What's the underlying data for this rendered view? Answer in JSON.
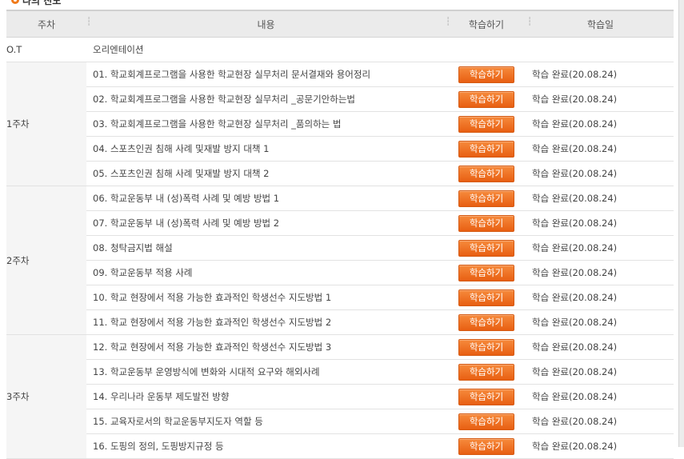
{
  "section_title": "나의 진도",
  "headers": {
    "week": "주차",
    "content": "내용",
    "study": "학습하기",
    "date": "학습일"
  },
  "separator_glyph": "┆",
  "ot": {
    "week": "O.T",
    "content": "오리엔테이션"
  },
  "weeks": [
    {
      "label": "1주차",
      "lessons": [
        {
          "title": "01. 학교회계프로그램을 사용한 학교현장 실무처리 문서결재와 용어정리",
          "button": "학습하기",
          "date": "학습 완료(20.08.24)"
        },
        {
          "title": "02. 학교회계프로그램을 사용한 학교현장 실무처리 _공문기안하는법",
          "button": "학습하기",
          "date": "학습 완료(20.08.24)"
        },
        {
          "title": "03. 학교회계프로그램을 사용한 학교현장 실무처리 _품의하는 법",
          "button": "학습하기",
          "date": "학습 완료(20.08.24)"
        },
        {
          "title": "04. 스포츠인권 침해 사례 및재발 방지 대책 1",
          "button": "학습하기",
          "date": "학습 완료(20.08.24)"
        },
        {
          "title": "05. 스포츠인권 침해 사례 및재발 방지 대책 2",
          "button": "학습하기",
          "date": "학습 완료(20.08.24)"
        }
      ]
    },
    {
      "label": "2주차",
      "lessons": [
        {
          "title": "06. 학교운동부 내 (성)폭력 사례 및 예방 방법 1",
          "button": "학습하기",
          "date": "학습 완료(20.08.24)"
        },
        {
          "title": "07. 학교운동부 내 (성)폭력 사례 및 예방 방법 2",
          "button": "학습하기",
          "date": "학습 완료(20.08.24)"
        },
        {
          "title": "08. 청탁금지법 해설",
          "button": "학습하기",
          "date": "학습 완료(20.08.24)"
        },
        {
          "title": "09. 학교운동부 적용 사례",
          "button": "학습하기",
          "date": "학습 완료(20.08.24)"
        },
        {
          "title": "10. 학교 현장에서 적용 가능한 효과적인 학생선수 지도방법 1",
          "button": "학습하기",
          "date": "학습 완료(20.08.24)"
        },
        {
          "title": "11. 학교 현장에서 적용 가능한 효과적인 학생선수 지도방법 2",
          "button": "학습하기",
          "date": "학습 완료(20.08.24)"
        }
      ]
    },
    {
      "label": "3주차",
      "lessons": [
        {
          "title": "12. 학교 현장에서 적용 가능한 효과적인 학생선수 지도방법 3",
          "button": "학습하기",
          "date": "학습 완료(20.08.24)"
        },
        {
          "title": "13. 학교운동부 운영방식에 변화와 시대적 요구와 해외사례",
          "button": "학습하기",
          "date": "학습 완료(20.08.24)"
        },
        {
          "title": "14. 우리나라 운동부 제도발전 방향",
          "button": "학습하기",
          "date": "학습 완료(20.08.24)"
        },
        {
          "title": "15. 교육자로서의 학교운동부지도자 역할 등",
          "button": "학습하기",
          "date": "학습 완료(20.08.24)"
        },
        {
          "title": "16. 도핑의 정의, 도핑방지규정 등",
          "button": "학습하기",
          "date": "학습 완료(20.08.24)"
        }
      ]
    }
  ]
}
